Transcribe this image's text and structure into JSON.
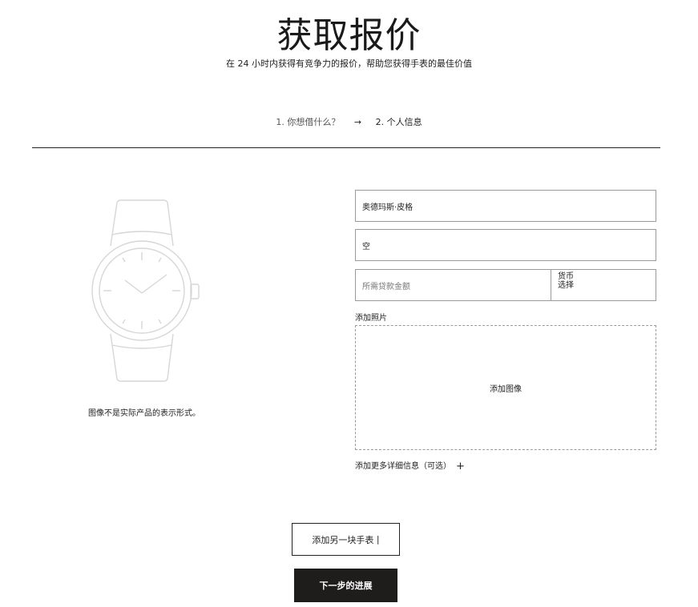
{
  "header": {
    "title": "获取报价",
    "subtitle": "在 24 小时内获得有竞争力的报价，帮助您获得手表的最佳价值"
  },
  "steps": {
    "step1": "1. 你想借什么？",
    "arrow": "→",
    "step2": "2. 个人信息"
  },
  "watch": {
    "icon": "watch-outline-icon",
    "caption": "图像不是实际产品的表示形式。"
  },
  "form": {
    "brand_value": "奥德玛斯·皮格",
    "model_value": "空",
    "amount_placeholder": "所需贷款金额",
    "currency_label": "货币",
    "currency_value": "选择",
    "photo_label": "添加照片",
    "dropzone_text": "添加图像",
    "more_details": "添加更多详细信息（可选）",
    "more_details_icon": "+"
  },
  "actions": {
    "add_watch": "添加另一块手表",
    "add_watch_suffix": "|",
    "next": "下一步的进展"
  },
  "colors": {
    "primary_button": "#1f1c1c",
    "border": "#9a9a9a"
  }
}
